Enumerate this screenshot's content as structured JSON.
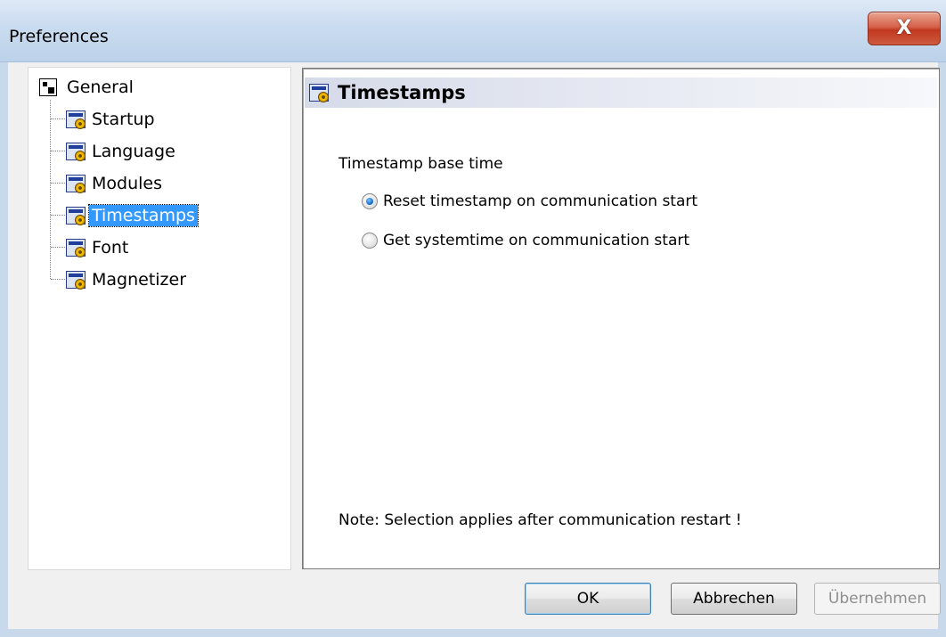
{
  "window": {
    "title": "Preferences",
    "close_label": "X"
  },
  "tree": {
    "root_label": "General",
    "items": [
      {
        "label": "Startup",
        "selected": false
      },
      {
        "label": "Language",
        "selected": false
      },
      {
        "label": "Modules",
        "selected": false
      },
      {
        "label": "Timestamps",
        "selected": true
      },
      {
        "label": "Font",
        "selected": false
      },
      {
        "label": "Magnetizer",
        "selected": false
      }
    ]
  },
  "content": {
    "title": "Timestamps",
    "section_label": "Timestamp base time",
    "options": [
      {
        "label": "Reset timestamp on communication start",
        "checked": true
      },
      {
        "label": "Get systemtime on communication start",
        "checked": false
      }
    ],
    "note": "Note: Selection applies after communication restart !"
  },
  "buttons": {
    "ok": "OK",
    "cancel": "Abbrechen",
    "apply": "Übernehmen"
  },
  "colors": {
    "selection": "#3399ff",
    "close_button": "#c0391f",
    "title_bar": "#c9dbef"
  }
}
